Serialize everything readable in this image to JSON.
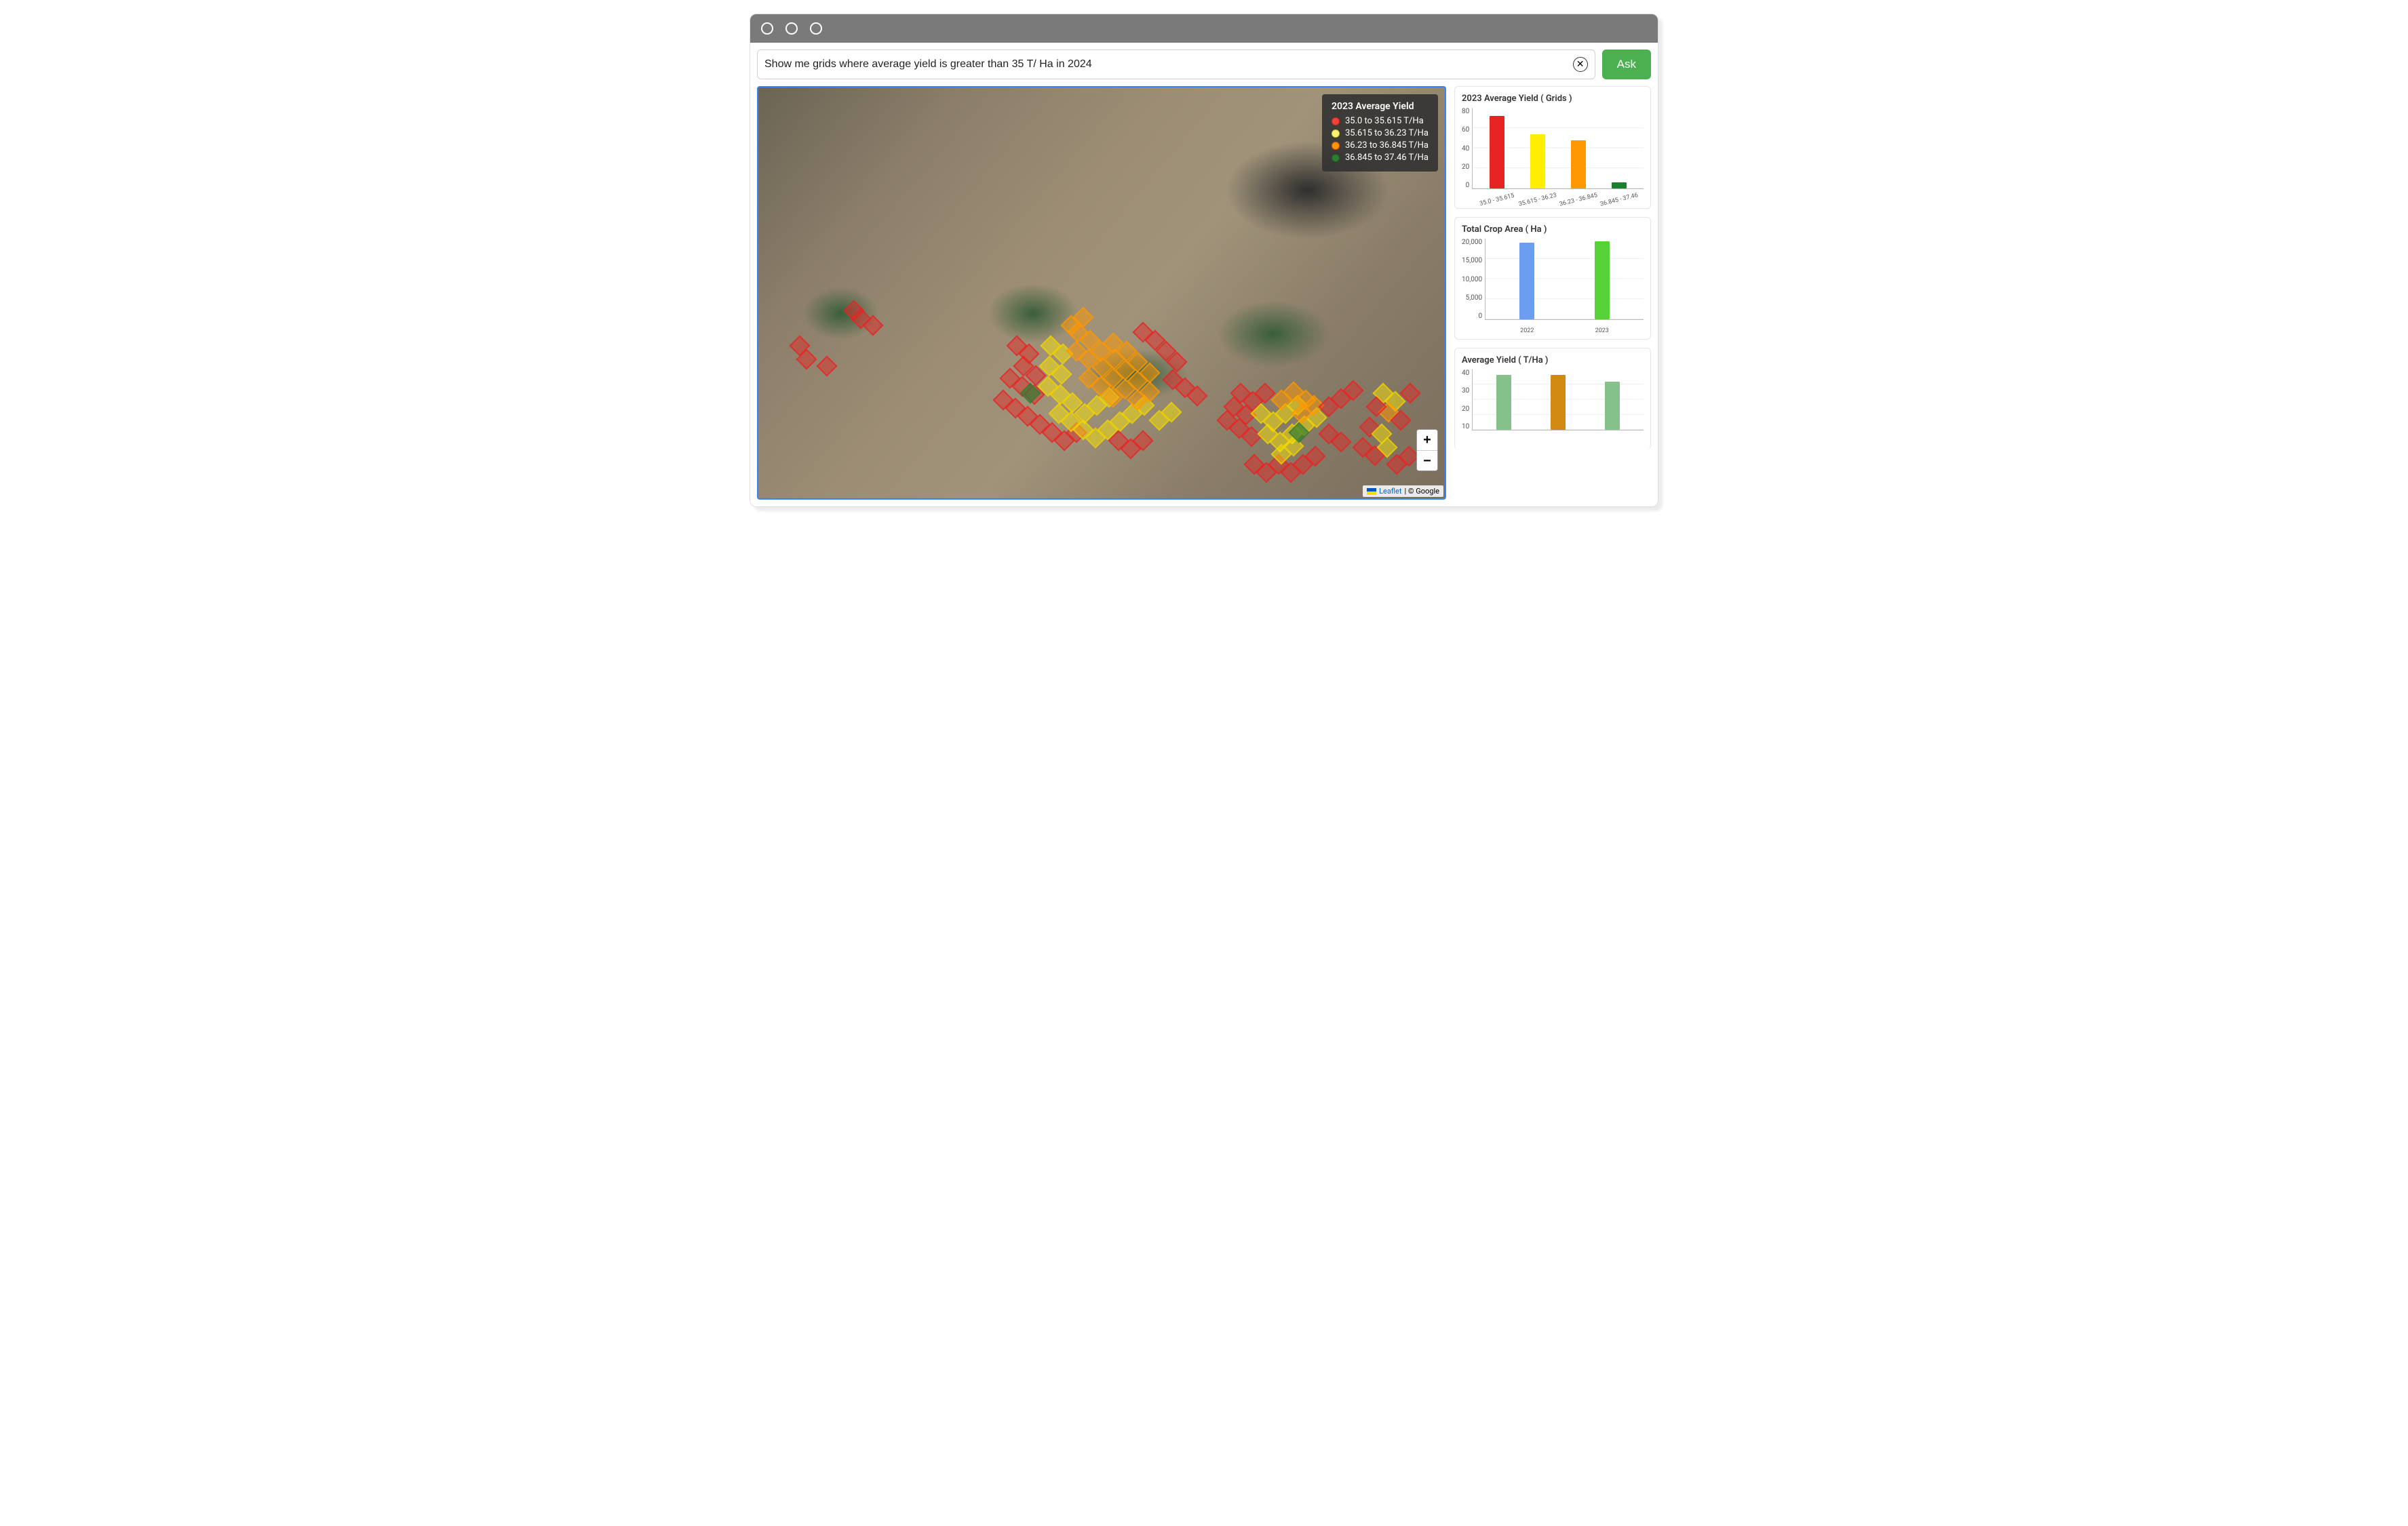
{
  "query": {
    "value": "Show me grids where average yield is greater than 35 T/ Ha in 2024",
    "clear_symbol": "✕",
    "ask_label": "Ask"
  },
  "map": {
    "legend_title": "2023 Average Yield",
    "legend_items": [
      {
        "label": "35.0 to 35.615 T/Ha",
        "color_class": "sw-red"
      },
      {
        "label": "35.615 to 36.23 T/Ha",
        "color_class": "sw-yellow"
      },
      {
        "label": "36.23 to 36.845 T/Ha",
        "color_class": "sw-orange"
      },
      {
        "label": "36.845 to 37.46 T/Ha",
        "color_class": "sw-green"
      }
    ],
    "zoom_in": "+",
    "zoom_out": "−",
    "attribution_leaflet": "Leaflet",
    "attribution_rest": " | © Google"
  },
  "charts": {
    "grids": {
      "title": "2023 Average Yield ( Grids )",
      "y_ticks": [
        "80",
        "60",
        "40",
        "20",
        "0"
      ],
      "bars": [
        {
          "label": "35.0 - 35.615",
          "value": 72,
          "max": 80,
          "color": "#e72424"
        },
        {
          "label": "35.615 - 36.23",
          "value": 54,
          "max": 80,
          "color": "#ffee00"
        },
        {
          "label": "36.23 - 36.845",
          "value": 48,
          "max": 80,
          "color": "#ff9800"
        },
        {
          "label": "36.845 - 37.46",
          "value": 6,
          "max": 80,
          "color": "#1b7f2e"
        }
      ]
    },
    "crop_area": {
      "title": "Total Crop Area ( Ha )",
      "y_ticks": [
        "20,000",
        "15,000",
        "10,000",
        "5,000",
        "0"
      ],
      "bars": [
        {
          "label": "2022",
          "value": 19000,
          "max": 20000,
          "color": "#6b9ef0"
        },
        {
          "label": "2023",
          "value": 19300,
          "max": 20000,
          "color": "#57d236"
        }
      ]
    },
    "avg_yield": {
      "title": "Average Yield ( T/Ha )",
      "y_ticks": [
        "40",
        "30",
        "20",
        "10"
      ],
      "bars": [
        {
          "label": "",
          "value": 41,
          "max": 45,
          "color": "#85c18a"
        },
        {
          "label": "",
          "value": 41,
          "max": 45,
          "color": "#d38a12"
        },
        {
          "label": "",
          "value": 36,
          "max": 45,
          "color": "#85c18a"
        }
      ]
    }
  },
  "chart_data": [
    {
      "type": "bar",
      "title": "2023 Average Yield ( Grids )",
      "categories": [
        "35.0 - 35.615",
        "35.615 - 36.23",
        "36.23 - 36.845",
        "36.845 - 37.46"
      ],
      "values": [
        72,
        54,
        48,
        6
      ],
      "ylim": [
        0,
        80
      ],
      "colors": [
        "#e72424",
        "#ffee00",
        "#ff9800",
        "#1b7f2e"
      ]
    },
    {
      "type": "bar",
      "title": "Total Crop Area ( Ha )",
      "categories": [
        "2022",
        "2023"
      ],
      "values": [
        19000,
        19300
      ],
      "ylim": [
        0,
        20000
      ],
      "colors": [
        "#6b9ef0",
        "#57d236"
      ]
    },
    {
      "type": "bar",
      "title": "Average Yield ( T/Ha )",
      "categories": [
        "",
        "",
        ""
      ],
      "values": [
        41,
        41,
        36
      ],
      "ylim": [
        0,
        45
      ],
      "colors": [
        "#85c18a",
        "#d38a12",
        "#85c18a"
      ]
    }
  ]
}
